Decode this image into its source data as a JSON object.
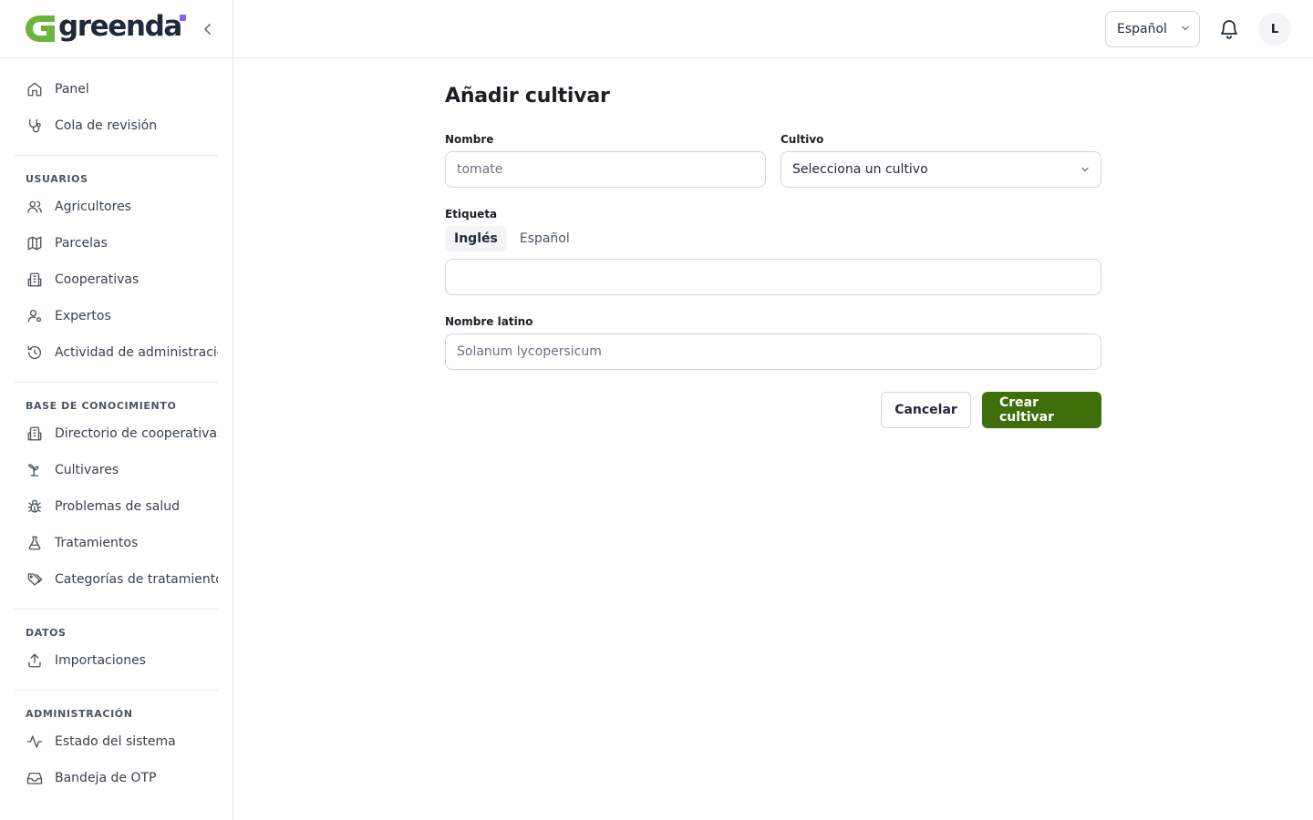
{
  "brand": {
    "name": "greenda",
    "logo_color": "#6db33f",
    "dot_color": "#8b5cf6"
  },
  "sidebar": {
    "groups": [
      {
        "label": "",
        "items": [
          {
            "label": "Panel",
            "icon": "home-icon"
          },
          {
            "label": "Cola de revisión",
            "icon": "stethoscope-icon"
          }
        ]
      },
      {
        "label": "USUARIOS",
        "items": [
          {
            "label": "Agricultores",
            "icon": "users-icon"
          },
          {
            "label": "Parcelas",
            "icon": "map-icon"
          },
          {
            "label": "Cooperativas",
            "icon": "building-icon"
          },
          {
            "label": "Expertos",
            "icon": "user-cog-icon"
          },
          {
            "label": "Actividad de administración",
            "icon": "history-icon"
          }
        ]
      },
      {
        "label": "BASE DE CONOCIMIENTO",
        "items": [
          {
            "label": "Directorio de cooperativas",
            "icon": "building-icon"
          },
          {
            "label": "Cultivares",
            "icon": "sprout-icon"
          },
          {
            "label": "Problemas de salud",
            "icon": "bug-icon"
          },
          {
            "label": "Tratamientos",
            "icon": "flask-icon"
          },
          {
            "label": "Categorías de tratamientos",
            "icon": "tags-icon"
          }
        ]
      },
      {
        "label": "DATOS",
        "items": [
          {
            "label": "Importaciones",
            "icon": "upload-icon"
          }
        ]
      },
      {
        "label": "ADMINISTRACIÓN",
        "items": [
          {
            "label": "Estado del sistema",
            "icon": "activity-icon"
          },
          {
            "label": "Bandeja de OTP",
            "icon": "inbox-icon"
          }
        ]
      }
    ]
  },
  "header": {
    "language": "Español",
    "avatar_initial": "L"
  },
  "form": {
    "title": "Añadir cultivar",
    "name_label": "Nombre",
    "name_placeholder": "tomate",
    "crop_label": "Cultivo",
    "crop_value": "Selecciona un cultivo",
    "tag_label": "Etiqueta",
    "tabs": [
      "Inglés",
      "Español"
    ],
    "active_tab": "Inglés",
    "tag_value": "",
    "latin_label": "Nombre latino",
    "latin_placeholder": "Solanum lycopersicum",
    "cancel_label": "Cancelar",
    "submit_label": "Crear cultivar",
    "primary_color": "#3f6f0a"
  }
}
